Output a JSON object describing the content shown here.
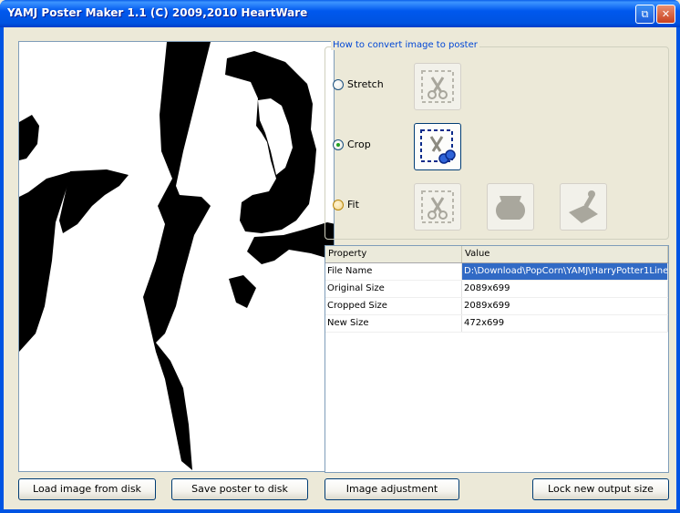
{
  "window": {
    "title": "YAMJ Poster Maker 1.1 (C) 2009,2010 HeartWare"
  },
  "options": {
    "group_label": "How to convert image to poster",
    "modes": [
      {
        "label": "Stretch",
        "selected": false
      },
      {
        "label": "Crop",
        "selected": true
      },
      {
        "label": "Fit",
        "selected": false
      }
    ]
  },
  "properties": {
    "columns": [
      "Property",
      "Value"
    ],
    "rows": [
      {
        "property": "File Name",
        "value": "D:\\Download\\PopCorn\\YAMJ\\HarryPotter1Line"
      },
      {
        "property": "Original Size",
        "value": "2089x699"
      },
      {
        "property": "Cropped Size",
        "value": "2089x699"
      },
      {
        "property": "New Size",
        "value": "472x699"
      }
    ]
  },
  "buttons": {
    "load": "Load image from disk",
    "save": "Save poster to disk",
    "adjust": "Image adjustment",
    "lock": "Lock new output size"
  },
  "icons": {
    "restore": "restore-icon",
    "scissors": "scissors-icon",
    "jar": "jar-icon",
    "stamp": "stamp-icon"
  },
  "colors": {
    "title_bar": "#0054E3",
    "selection": "#316AC5",
    "group_label": "#0046D5"
  }
}
